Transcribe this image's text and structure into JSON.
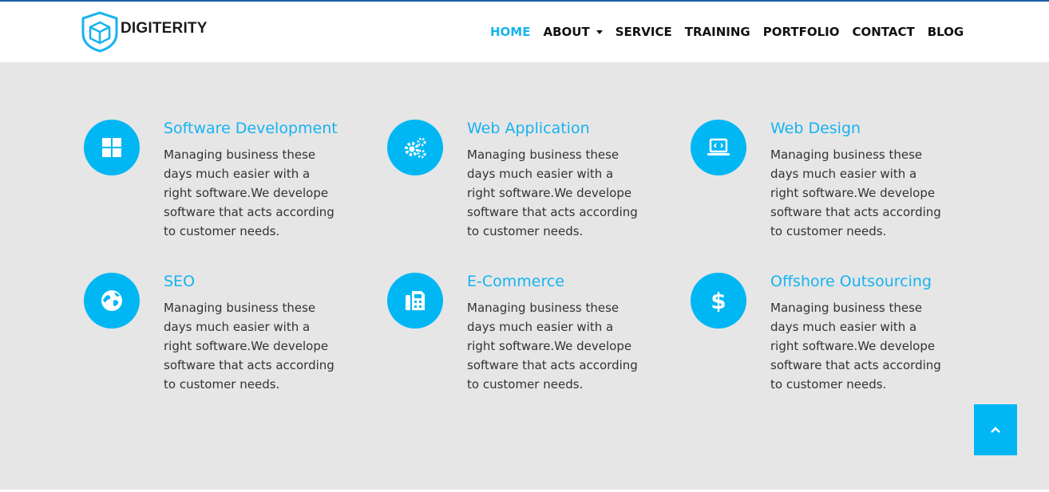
{
  "brand": {
    "name": "DIGITERITY",
    "accent": "#17b3f0"
  },
  "nav": {
    "items": [
      {
        "label": "HOME",
        "active": true
      },
      {
        "label": "ABOUT",
        "dropdown": true
      },
      {
        "label": "SERVICE"
      },
      {
        "label": "TRAINING"
      },
      {
        "label": "PORTFOLIO"
      },
      {
        "label": "CONTACT"
      },
      {
        "label": "BLOG"
      }
    ]
  },
  "services": [
    {
      "title": "Software Development",
      "icon": "windows-icon",
      "desc": "Managing business these days much easier with a right software.We develope software that acts according to customer needs."
    },
    {
      "title": "Web Application",
      "icon": "gears-icon",
      "desc": "Managing business these days much easier with a right software.We develope software that acts according to customer needs."
    },
    {
      "title": "Web Design",
      "icon": "laptop-code-icon",
      "desc": "Managing business these days much easier with a right software.We develope software that acts according to customer needs."
    },
    {
      "title": "SEO",
      "icon": "globe-icon",
      "desc": "Managing business these days much easier with a right software.We develope software that acts according to customer needs."
    },
    {
      "title": "E-Commerce",
      "icon": "fax-icon",
      "desc": "Managing business these days much easier with a right software.We develope software that acts according to customer needs."
    },
    {
      "title": "Offshore Outsourcing",
      "icon": "dollar-icon",
      "desc": "Managing business these days much easier with a right software.We develope software that acts according to customer needs."
    }
  ],
  "scroll_top": {
    "icon": "chevron-up-icon"
  }
}
